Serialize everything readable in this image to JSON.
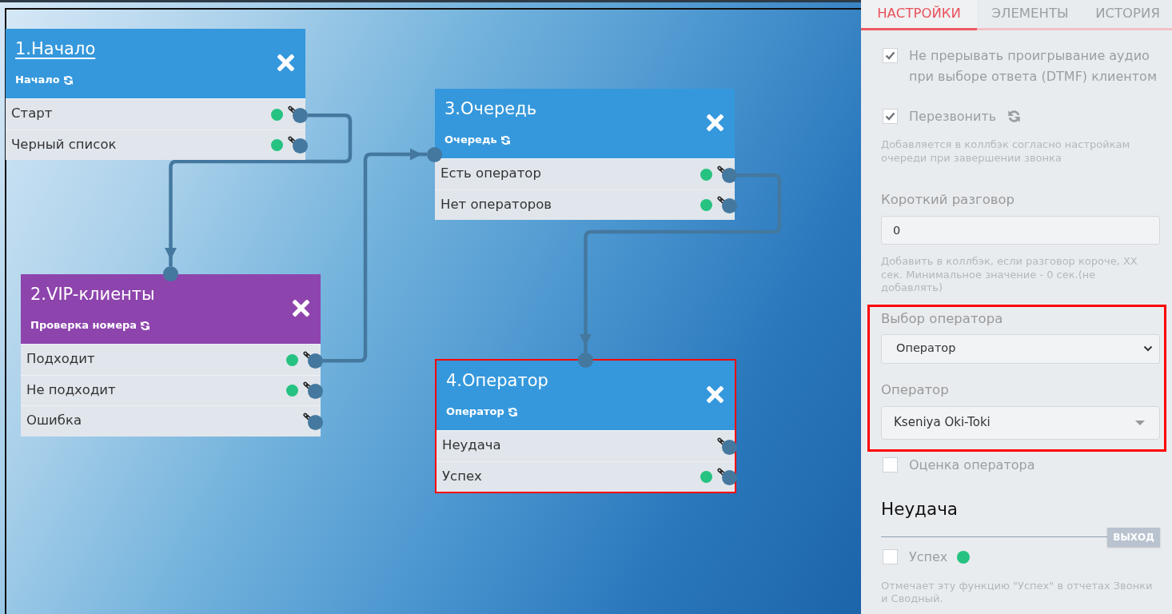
{
  "canvas": {
    "nodes": [
      {
        "title": "1.Начало",
        "underlined": true,
        "type": "Начало",
        "color": "#3598dc",
        "highlighted": false,
        "outputs": [
          {
            "label": "Старт",
            "dot": true,
            "connected": true
          },
          {
            "label": "Черный список",
            "dot": true,
            "connected": false
          }
        ]
      },
      {
        "title": "2.VIP-клиенты",
        "underlined": false,
        "type": "Проверка номера",
        "color": "#8e44ad",
        "highlighted": false,
        "outputs": [
          {
            "label": "Подходит",
            "dot": true,
            "connected": true
          },
          {
            "label": "Не подходит",
            "dot": true,
            "connected": false
          },
          {
            "label": "Ошибка",
            "dot": false,
            "connected": false
          }
        ]
      },
      {
        "title": "3.Очередь",
        "underlined": false,
        "type": "Очередь",
        "color": "#3598dc",
        "highlighted": false,
        "outputs": [
          {
            "label": "Есть оператор",
            "dot": true,
            "connected": true
          },
          {
            "label": "Нет операторов",
            "dot": true,
            "connected": false
          }
        ]
      },
      {
        "title": "4.Оператор",
        "underlined": false,
        "type": "Оператор",
        "color": "#3598dc",
        "highlighted": true,
        "outputs": [
          {
            "label": "Неудача",
            "dot": false,
            "connected": false
          },
          {
            "label": "Успех",
            "dot": true,
            "connected": false
          }
        ]
      }
    ]
  },
  "panel": {
    "tabs": [
      {
        "label": "НАСТРОЙКИ",
        "selected": true
      },
      {
        "label": "ЭЛЕМЕНТЫ",
        "selected": false
      },
      {
        "label": "ИСТОРИЯ",
        "selected": false
      }
    ],
    "fields": [
      {
        "kind": "checkbox",
        "label": "Не прерывать проигрывание аудио при выборе ответа (DTMF) клиентом",
        "checked": true,
        "reload": false
      },
      {
        "kind": "checkbox",
        "label": "Перезвонить",
        "checked": true,
        "reload": true,
        "hint": "Добавляется в коллбэк согласно настройкам очереди при завершении звонка"
      },
      {
        "kind": "number",
        "label": "Короткий разговор",
        "value": "0",
        "hint": "Добавить в коллбэк, если разговор короче, XX сек. Минимальное значение - 0 сек.(не добавлять)"
      },
      {
        "kind": "group",
        "highlighted": true,
        "children": [
          {
            "kind": "select",
            "label": "Выбор оператора",
            "value": "Оператор"
          },
          {
            "kind": "combobox",
            "label": "Оператор",
            "value": "Kseniya Oki-Toki"
          }
        ]
      },
      {
        "kind": "checkbox",
        "label": "Оценка оператора",
        "checked": false,
        "reload": false
      }
    ],
    "exit": {
      "title": "Неудача",
      "tag": "ВЫХОД",
      "option": {
        "label": "Успех",
        "checked": false,
        "dot": true
      },
      "hint": "Отмечает эту функцию \"Успех\" в отчетах Звонки и Сводный."
    }
  }
}
